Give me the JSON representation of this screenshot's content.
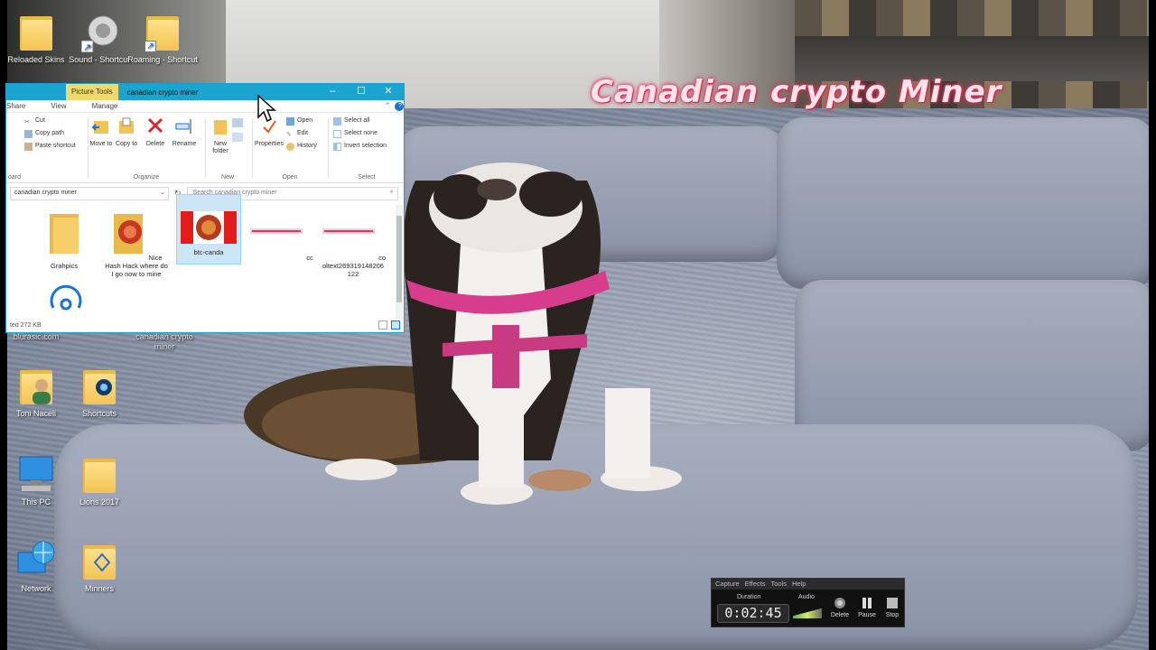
{
  "overlay_title": "Canadian crypto Miner",
  "desktop_icons": [
    {
      "label": "Reloaded Skins",
      "kind": "folder-docs"
    },
    {
      "label": "Sound - Shortcut",
      "kind": "speaker"
    },
    {
      "label": "Roaming - Shortcut",
      "kind": "folder"
    },
    {
      "label": "Toni Naceli",
      "kind": "user-folder"
    },
    {
      "label": "Shortcuts",
      "kind": "folder-app"
    },
    {
      "label": "This PC",
      "kind": "pc"
    },
    {
      "label": "Lions 2017",
      "kind": "folder-docs"
    },
    {
      "label": "Network",
      "kind": "network"
    },
    {
      "label": "Minners",
      "kind": "folder-app"
    },
    {
      "label": "canadian crypto miner",
      "kind": "hidden"
    },
    {
      "label": "blurasic.com",
      "kind": "hidden"
    }
  ],
  "explorer": {
    "context_tab": "Picture Tools",
    "window_title": "canadian crypto miner",
    "tabs": [
      "Share",
      "View",
      "Manage"
    ],
    "ribbon": {
      "clipboard": {
        "cut": "Cut",
        "copy_path": "Copy path",
        "paste_shortcut": "Paste shortcut",
        "group": "oard"
      },
      "organize": {
        "move_to": "Move to",
        "copy_to": "Copy to",
        "delete": "Delete",
        "rename": "Rename",
        "group": "Organize"
      },
      "new": {
        "new_folder": "New folder",
        "group": "New"
      },
      "open": {
        "properties": "Properties",
        "open": "Open",
        "edit": "Edit",
        "history": "History",
        "group": "Open"
      },
      "select": {
        "select_all": "Select all",
        "select_none": "Select none",
        "invert_selection": "Invert selection",
        "group": "Select"
      }
    },
    "address": "canadian crypto miner",
    "search_placeholder": "Search canadian crypto miner",
    "files": [
      {
        "name": "Grahpics",
        "type": "folder"
      },
      {
        "name": "Nice Hash Hack where do I go now to mine",
        "type": "folder-image"
      },
      {
        "name": "btc-canda",
        "type": "image-flag",
        "selected": true
      },
      {
        "name": "cc",
        "type": "image-text"
      },
      {
        "name": "cooltext269319148206122",
        "type": "image-text"
      },
      {
        "name": "",
        "type": "app"
      }
    ],
    "status": "ted  272 KB"
  },
  "recorder": {
    "menu": [
      "Capture",
      "Effects",
      "Tools",
      "Help"
    ],
    "duration_label": "Duration",
    "duration": "0:02:45",
    "audio_label": "Audio",
    "buttons": {
      "delete": "Delete",
      "pause": "Pause",
      "stop": "Stop"
    }
  },
  "colors": {
    "explorer_title": "#19a5cf",
    "picture_tools": "#f3d86a",
    "overlay_glow": "#e0325c",
    "selection": "#cce6f7"
  }
}
